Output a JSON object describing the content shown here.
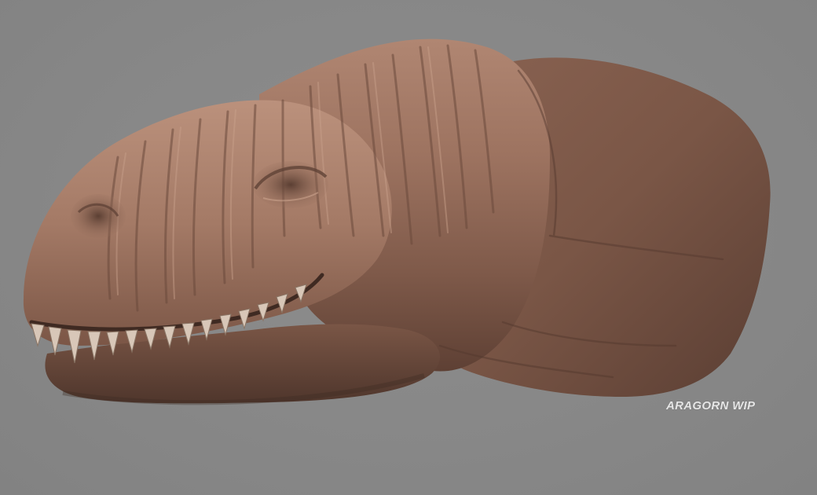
{
  "viewport": {
    "background_color": "#878787",
    "subject": "creature-sculpt",
    "skin_color": "#9a6f5c"
  },
  "watermark": {
    "text": "ARAGORN WIP"
  }
}
